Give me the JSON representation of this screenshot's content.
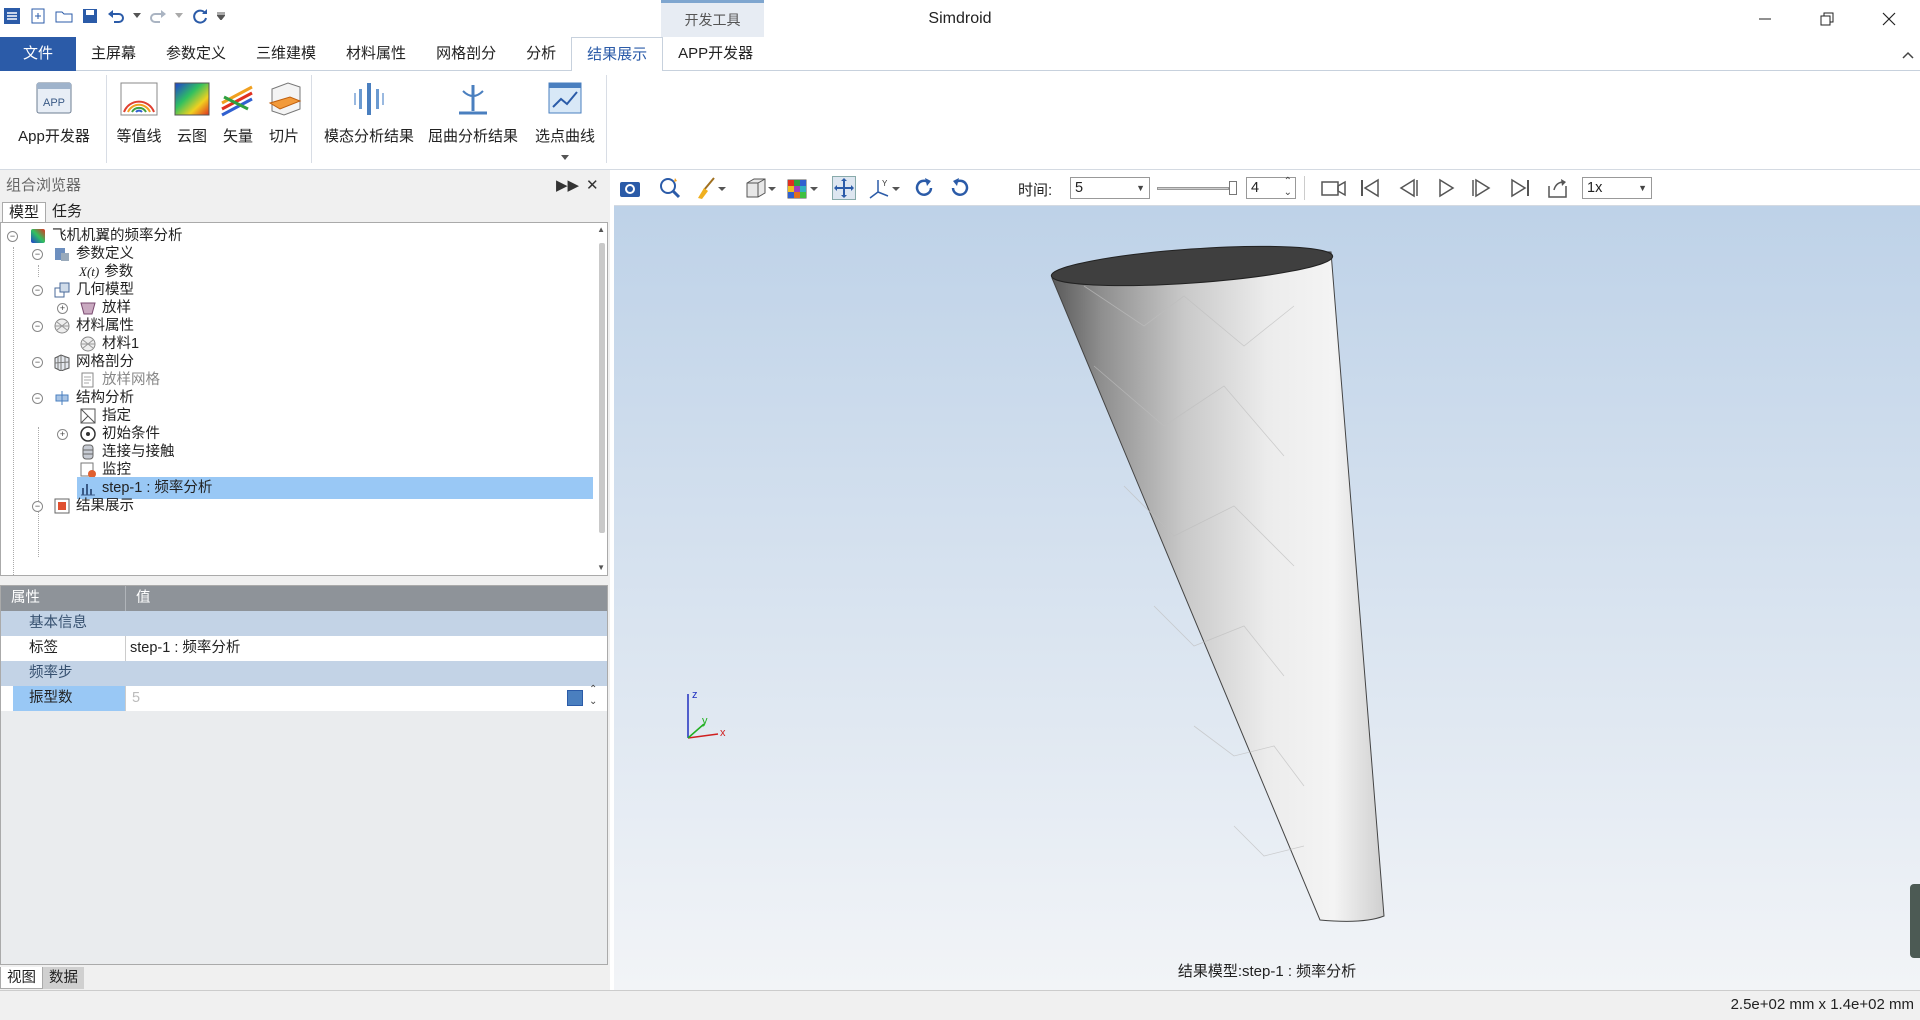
{
  "app": {
    "title": "Simdroid",
    "context_tab": "开发工具"
  },
  "menu": {
    "file": "文件",
    "tabs": [
      "主屏幕",
      "参数定义",
      "三维建模",
      "材料属性",
      "网格剖分",
      "分析",
      "结果展示",
      "APP开发器"
    ],
    "active_tab": "结果展示"
  },
  "ribbon": {
    "app_dev": "App开发器",
    "contour": "等值线",
    "cloud": "云图",
    "vector": "矢量",
    "slice": "切片",
    "modal": "模态分析结果",
    "buckling": "屈曲分析结果",
    "pick_curve": "选点曲线"
  },
  "browser": {
    "title": "组合浏览器",
    "tabs": [
      "模型",
      "任务"
    ],
    "tree": [
      {
        "label": "飞机机翼的频率分析",
        "icon": "result-color-icon"
      },
      {
        "label": "参数定义",
        "icon": "param-def-icon"
      },
      {
        "label": "参数",
        "icon": "xy-param-icon",
        "prefix": "X(t)"
      },
      {
        "label": "几何模型",
        "icon": "geometry-icon"
      },
      {
        "label": "放样",
        "icon": "loft-icon"
      },
      {
        "label": "材料属性",
        "icon": "material-icon"
      },
      {
        "label": "材料1",
        "icon": "material-icon"
      },
      {
        "label": "网格剖分",
        "icon": "mesh-icon"
      },
      {
        "label": "放样网格",
        "icon": "mesh-doc-icon"
      },
      {
        "label": "结构分析",
        "icon": "structure-icon"
      },
      {
        "label": "指定",
        "icon": "assign-icon"
      },
      {
        "label": "初始条件",
        "icon": "initial-cond-icon"
      },
      {
        "label": "连接与接触",
        "icon": "contact-icon"
      },
      {
        "label": "监控",
        "icon": "monitor-icon"
      },
      {
        "label": "step-1 : 频率分析",
        "icon": "step-chart-icon"
      },
      {
        "label": "结果展示",
        "icon": "result-icon"
      }
    ]
  },
  "properties": {
    "col_prop": "属性",
    "col_value": "值",
    "group_basic": "基本信息",
    "label_key": "标签",
    "label_value": "step-1 : 频率分析",
    "group_freq": "频率步",
    "modes_key": "振型数",
    "modes_value": "5"
  },
  "bottom_tabs": [
    "视图",
    "数据"
  ],
  "viewtool": {
    "time_label": "时间:",
    "time_value": "5",
    "frame_value": "4",
    "speed": "1x"
  },
  "viewport": {
    "caption": "结果模型:step-1 : 频率分析",
    "axis_x": "x",
    "axis_y": "y",
    "axis_z": "z"
  },
  "status": {
    "dimensions": "2.5e+02 mm x 1.4e+02 mm"
  },
  "colors": {
    "accent": "#2b5ba8",
    "selection": "#99c8f5",
    "viewport_top": "#bed2e8"
  }
}
